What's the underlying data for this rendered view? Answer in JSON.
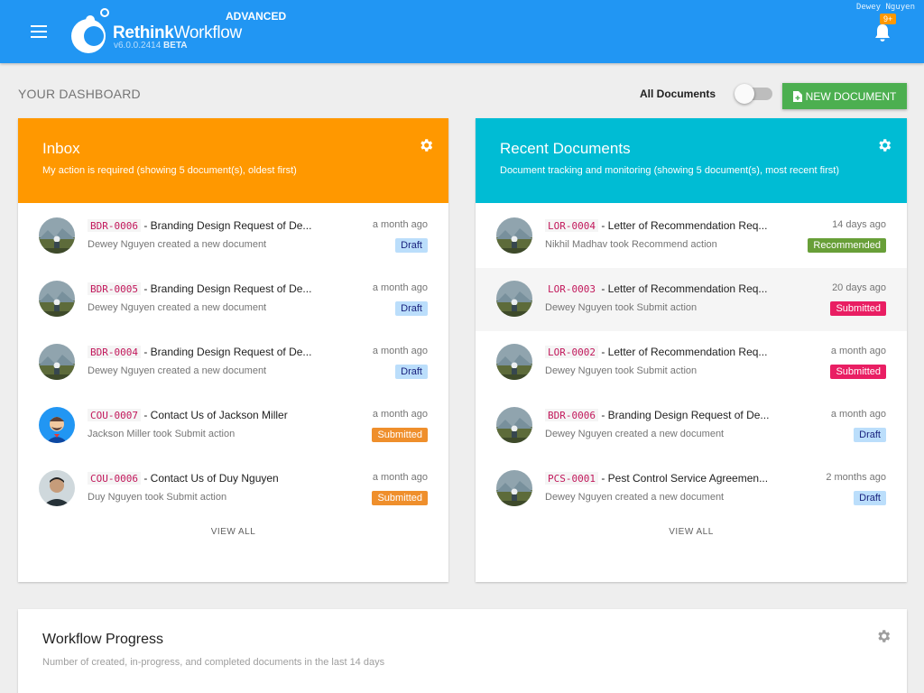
{
  "header": {
    "brand_bold": "Rethink",
    "brand_light": "Workflow",
    "edition": "ADVANCED",
    "version": "v6.0.0.2414",
    "version_tag": "BETA",
    "user": "Dewey Nguyen",
    "notification_count": "9+"
  },
  "toolbar": {
    "title": "YOUR DASHBOARD",
    "toggle_label": "All Documents",
    "toggle_on": false,
    "new_doc_label": "NEW DOCUMENT"
  },
  "inbox": {
    "title": "Inbox",
    "subtitle": "My action is required (showing 5 document(s), oldest first)",
    "view_all": "VIEW ALL",
    "items": [
      {
        "code": "BDR-0006",
        "title": "- Branding Design Request of De...",
        "desc": "Dewey Nguyen created a new document",
        "time": "a month ago",
        "status": "Draft",
        "status_class": "st-draft",
        "avatar": "landscape"
      },
      {
        "code": "BDR-0005",
        "title": "- Branding Design Request of De...",
        "desc": "Dewey Nguyen created a new document",
        "time": "a month ago",
        "status": "Draft",
        "status_class": "st-draft",
        "avatar": "landscape"
      },
      {
        "code": "BDR-0004",
        "title": "- Branding Design Request of De...",
        "desc": "Dewey Nguyen created a new document",
        "time": "a month ago",
        "status": "Draft",
        "status_class": "st-draft",
        "avatar": "landscape"
      },
      {
        "code": "COU-0007",
        "title": "- Contact Us of Jackson Miller",
        "desc": "Jackson Miller took Submit action",
        "time": "a month ago",
        "status": "Submitted",
        "status_class": "st-submitted-orange",
        "avatar": "cartoon"
      },
      {
        "code": "COU-0006",
        "title": "- Contact Us of Duy Nguyen",
        "desc": "Duy Nguyen took Submit action",
        "time": "a month ago",
        "status": "Submitted",
        "status_class": "st-submitted-orange",
        "avatar": "person"
      }
    ]
  },
  "recent": {
    "title": "Recent Documents",
    "subtitle": "Document tracking and monitoring (showing 5 document(s), most recent first)",
    "view_all": "VIEW ALL",
    "items": [
      {
        "code": "LOR-0004",
        "title": "- Letter of Recommendation Req...",
        "desc": "Nikhil Madhav took Recommend action",
        "time": "14 days ago",
        "status": "Recommended",
        "status_class": "st-recommended",
        "avatar": "landscape"
      },
      {
        "code": "LOR-0003",
        "title": "- Letter of Recommendation Req...",
        "desc": "Dewey Nguyen took Submit action",
        "time": "20 days ago",
        "status": "Submitted",
        "status_class": "st-submitted-pink",
        "avatar": "landscape",
        "highlight": true
      },
      {
        "code": "LOR-0002",
        "title": "- Letter of Recommendation Req...",
        "desc": "Dewey Nguyen took Submit action",
        "time": "a month ago",
        "status": "Submitted",
        "status_class": "st-submitted-pink",
        "avatar": "landscape"
      },
      {
        "code": "BDR-0006",
        "title": "- Branding Design Request of De...",
        "desc": "Dewey Nguyen created a new document",
        "time": "a month ago",
        "status": "Draft",
        "status_class": "st-draft",
        "avatar": "landscape"
      },
      {
        "code": "PCS-0001",
        "title": "- Pest Control Service Agreemen...",
        "desc": "Dewey Nguyen created a new document",
        "time": "2 months ago",
        "status": "Draft",
        "status_class": "st-draft",
        "avatar": "landscape"
      }
    ]
  },
  "progress": {
    "title": "Workflow Progress",
    "subtitle": "Number of created, in-progress, and completed documents in the last 14 days"
  },
  "colors": {
    "appbar": "#2196f3",
    "inbox_header": "#ff9800",
    "recent_header": "#00bcd4",
    "new_doc_button": "#4caf50"
  }
}
